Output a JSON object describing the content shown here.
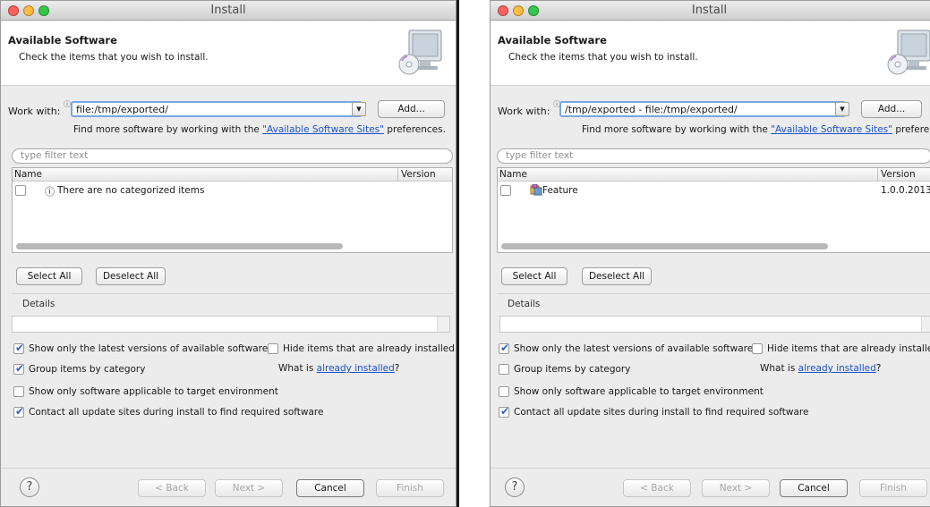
{
  "left": {
    "title": "Install",
    "banner_title": "Available Software",
    "banner_desc": "Check the items that you wish to install.",
    "work_with_label": "Work with:",
    "work_with_value": "file:/tmp/exported/",
    "add_label": "Add...",
    "find_more_prefix": "Find more software by working with the ",
    "find_more_link": "\"Available Software Sites\"",
    "find_more_suffix": " preferences.",
    "filter_placeholder": "type filter text",
    "col_name": "Name",
    "col_version": "Version",
    "row_text": "There are no categorized items",
    "select_all": "Select All",
    "deselect_all": "Deselect All",
    "details_label": "Details",
    "opt_latest": "Show only the latest versions of available software",
    "opt_hide": "Hide items that are already installed",
    "what_is": "What is ",
    "already_installed": "already installed",
    "what_is_suffix": "?",
    "opt_group": "Group items by category",
    "opt_target": "Show only software applicable to target environment",
    "opt_contact": "Contact all update sites during install to find required software",
    "back": "< Back",
    "next": "Next >",
    "cancel": "Cancel",
    "finish": "Finish"
  },
  "right": {
    "title": "Install",
    "banner_title": "Available Software",
    "banner_desc": "Check the items that you wish to install.",
    "work_with_label": "Work with:",
    "work_with_value": "/tmp/exported - file:/tmp/exported/",
    "add_label": "Add...",
    "find_more_prefix": "Find more software by working with the ",
    "find_more_link": "\"Available Software Sites\"",
    "find_more_suffix": " preferences.",
    "filter_placeholder": "type filter text",
    "col_name": "Name",
    "col_version": "Version",
    "row_text": "Feature",
    "row_version": "1.0.0.2013",
    "select_all": "Select All",
    "deselect_all": "Deselect All",
    "details_label": "Details",
    "opt_latest": "Show only the latest versions of available software",
    "opt_hide": "Hide items that are already installed",
    "what_is": "What is ",
    "already_installed": "already installed",
    "what_is_suffix": "?",
    "opt_group": "Group items by category",
    "opt_target": "Show only software applicable to target environment",
    "opt_contact": "Contact all update sites during install to find required software",
    "back": "< Back",
    "next": "Next >",
    "cancel": "Cancel",
    "finish": "Finish"
  },
  "checked_state": {
    "left": {
      "latest": true,
      "hide": false,
      "group": true,
      "target": false,
      "contact": true,
      "row": false
    },
    "right": {
      "latest": true,
      "hide": false,
      "group": false,
      "target": false,
      "contact": true,
      "row": false
    }
  },
  "icons": {
    "help": "?",
    "info": "ⓘ",
    "combo_arrow": "▼",
    "tick": "✔"
  }
}
